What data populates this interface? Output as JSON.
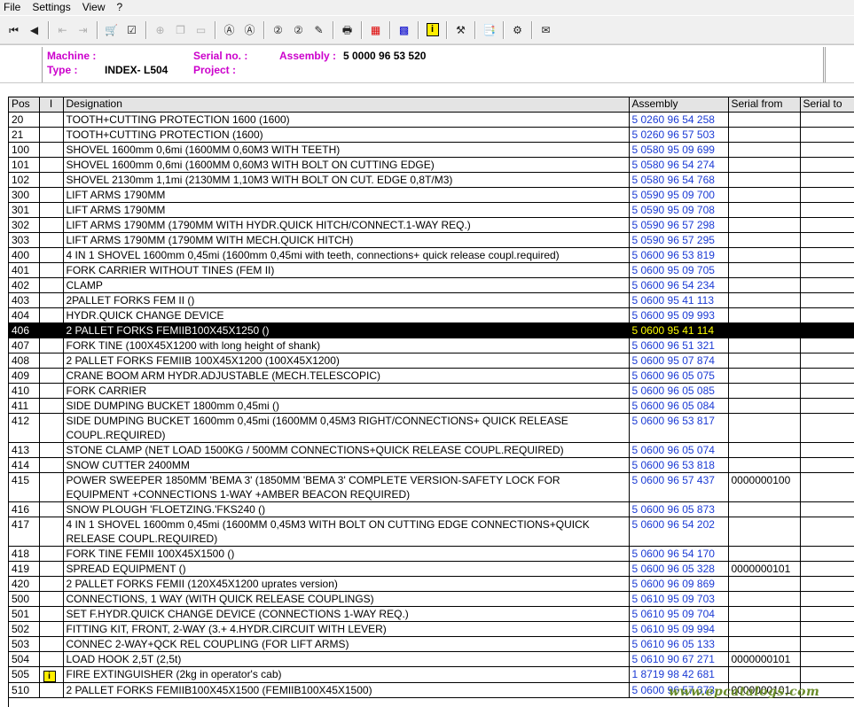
{
  "menu": [
    "File",
    "Settings",
    "View",
    "?"
  ],
  "toolbar": {
    "buttons": [
      {
        "name": "first-record-icon",
        "glyph": "⏮",
        "enabled": true
      },
      {
        "name": "prev-record-icon",
        "glyph": "◀",
        "enabled": true
      },
      {
        "name": "sep"
      },
      {
        "name": "back-doc-icon",
        "glyph": "⇤",
        "enabled": false
      },
      {
        "name": "forward-doc-icon",
        "glyph": "⇥",
        "enabled": false
      },
      {
        "name": "sep"
      },
      {
        "name": "basket-icon",
        "glyph": "🛒",
        "enabled": true
      },
      {
        "name": "edit-list-icon",
        "glyph": "☑",
        "enabled": true
      },
      {
        "name": "sep"
      },
      {
        "name": "zoom-in-icon",
        "glyph": "⊕",
        "enabled": false
      },
      {
        "name": "copy-icon",
        "glyph": "❐",
        "enabled": false
      },
      {
        "name": "page-icon",
        "glyph": "▭",
        "enabled": false
      },
      {
        "name": "sep"
      },
      {
        "name": "search-a-icon",
        "glyph": "Ⓐ",
        "enabled": true
      },
      {
        "name": "search-a-next-icon",
        "glyph": "Ⓐ",
        "enabled": true
      },
      {
        "name": "sep"
      },
      {
        "name": "search-2-icon",
        "glyph": "②",
        "enabled": true
      },
      {
        "name": "search-2-next-icon",
        "glyph": "②",
        "enabled": true
      },
      {
        "name": "note-icon",
        "glyph": "✎",
        "enabled": true
      },
      {
        "name": "sep"
      },
      {
        "name": "print-icon",
        "glyph": "🖶",
        "enabled": true
      },
      {
        "name": "sep"
      },
      {
        "name": "grid-red-icon",
        "glyph": "▦",
        "enabled": true,
        "color": "#dd0000"
      },
      {
        "name": "sep"
      },
      {
        "name": "grid-blue-icon",
        "glyph": "▩",
        "enabled": true,
        "color": "#0000cc"
      },
      {
        "name": "sep"
      },
      {
        "name": "info-icon",
        "glyph": "i",
        "enabled": true,
        "color": "#ffee00"
      },
      {
        "name": "sep"
      },
      {
        "name": "tools-icon",
        "glyph": "⚒",
        "enabled": true
      },
      {
        "name": "sep"
      },
      {
        "name": "catalog-icon",
        "glyph": "📑",
        "enabled": true
      },
      {
        "name": "sep"
      },
      {
        "name": "udds-icon",
        "glyph": "⚙",
        "enabled": true
      },
      {
        "name": "sep"
      },
      {
        "name": "mail-icon",
        "glyph": "✉",
        "enabled": true
      }
    ]
  },
  "header": {
    "machine_label": "Machine :",
    "machine_value": "",
    "type_label": "Type :",
    "type_value": "INDEX- L504",
    "serial_label": "Serial no. :",
    "serial_value": "",
    "project_label": "Project :",
    "project_value": "",
    "assembly_label": "Assembly :",
    "assembly_value": "5 0000 96 53 520"
  },
  "table": {
    "columns": [
      "Pos",
      "I",
      "Designation",
      "Assembly",
      "Serial from",
      "Serial to"
    ],
    "selected_pos": "406",
    "rows": [
      {
        "pos": "20",
        "i": "",
        "designation": "TOOTH+CUTTING PROTECTION 1600 (1600)",
        "assembly": "5 0260 96 54 258",
        "serial_from": "",
        "serial_to": ""
      },
      {
        "pos": "21",
        "i": "",
        "designation": "TOOTH+CUTTING PROTECTION (1600)",
        "assembly": "5 0260 96 57 503",
        "serial_from": "",
        "serial_to": ""
      },
      {
        "pos": "100",
        "i": "",
        "designation": "SHOVEL 1600mm 0,6mi (1600MM 0,60M3 WITH TEETH)",
        "assembly": "5 0580 95 09 699",
        "serial_from": "",
        "serial_to": ""
      },
      {
        "pos": "101",
        "i": "",
        "designation": "SHOVEL 1600mm 0,6mi (1600MM 0,60M3 WITH BOLT ON CUTTING EDGE)",
        "assembly": "5 0580 96 54 274",
        "serial_from": "",
        "serial_to": ""
      },
      {
        "pos": "102",
        "i": "",
        "designation": "SHOVEL 2130mm 1,1mi (2130MM 1,10M3 WITH BOLT ON CUT. EDGE 0,8T/M3)",
        "assembly": "5 0580 96 54 768",
        "serial_from": "",
        "serial_to": ""
      },
      {
        "pos": "300",
        "i": "",
        "designation": "LIFT ARMS 1790MM",
        "assembly": "5 0590 95 09 700",
        "serial_from": "",
        "serial_to": ""
      },
      {
        "pos": "301",
        "i": "",
        "designation": "LIFT ARMS 1790MM",
        "assembly": "5 0590 95 09 708",
        "serial_from": "",
        "serial_to": ""
      },
      {
        "pos": "302",
        "i": "",
        "designation": "LIFT ARMS 1790MM (1790MM WITH HYDR.QUICK HITCH/CONNECT.1-WAY REQ.)",
        "assembly": "5 0590 96 57 298",
        "serial_from": "",
        "serial_to": ""
      },
      {
        "pos": "303",
        "i": "",
        "designation": "LIFT ARMS 1790MM (1790MM WITH MECH.QUICK HITCH)",
        "assembly": "5 0590 96 57 295",
        "serial_from": "",
        "serial_to": ""
      },
      {
        "pos": "400",
        "i": "",
        "designation": "4 IN 1 SHOVEL 1600mm 0,45mi (1600mm 0,45mi with teeth, connections+ quick release coupl.required)",
        "assembly": "5 0600 96 53 819",
        "serial_from": "",
        "serial_to": ""
      },
      {
        "pos": "401",
        "i": "",
        "designation": "FORK CARRIER WITHOUT TINES (FEM II)",
        "assembly": "5 0600 95 09 705",
        "serial_from": "",
        "serial_to": ""
      },
      {
        "pos": "402",
        "i": "",
        "designation": "CLAMP",
        "assembly": "5 0600 96 54 234",
        "serial_from": "",
        "serial_to": ""
      },
      {
        "pos": "403",
        "i": "",
        "designation": "2PALLET FORKS FEM II ()",
        "assembly": "5 0600 95 41 113",
        "serial_from": "",
        "serial_to": ""
      },
      {
        "pos": "404",
        "i": "",
        "designation": "HYDR.QUICK CHANGE DEVICE",
        "assembly": "5 0600 95 09 993",
        "serial_from": "",
        "serial_to": ""
      },
      {
        "pos": "406",
        "i": "",
        "designation": "2 PALLET FORKS FEMIIB100X45X1250 ()",
        "assembly": "5 0600 95 41 114",
        "serial_from": "",
        "serial_to": ""
      },
      {
        "pos": "407",
        "i": "",
        "designation": "FORK TINE (100X45X1200 with long height of shank)",
        "assembly": "5 0600 96 51 321",
        "serial_from": "",
        "serial_to": ""
      },
      {
        "pos": "408",
        "i": "",
        "designation": "2 PALLET FORKS FEMIIB 100X45X1200 (100X45X1200)",
        "assembly": "5 0600 95 07 874",
        "serial_from": "",
        "serial_to": ""
      },
      {
        "pos": "409",
        "i": "",
        "designation": "CRANE BOOM ARM HYDR.ADJUSTABLE (MECH.TELESCOPIC)",
        "assembly": "5 0600 96 05 075",
        "serial_from": "",
        "serial_to": ""
      },
      {
        "pos": "410",
        "i": "",
        "designation": "FORK CARRIER",
        "assembly": "5 0600 96 05 085",
        "serial_from": "",
        "serial_to": ""
      },
      {
        "pos": "411",
        "i": "",
        "designation": "SIDE DUMPING BUCKET 1800mm 0,45mi ()",
        "assembly": "5 0600 96 05 084",
        "serial_from": "",
        "serial_to": ""
      },
      {
        "pos": "412",
        "i": "",
        "designation": "SIDE DUMPING BUCKET 1600mm 0,45mi (1600MM 0,45M3 RIGHT/CONNECTIONS+ QUICK RELEASE COUPL.REQUIRED)",
        "assembly": "5 0600 96 53 817",
        "serial_from": "",
        "serial_to": ""
      },
      {
        "pos": "413",
        "i": "",
        "designation": "STONE CLAMP (NET LOAD 1500KG / 500MM CONNECTIONS+QUICK RELEASE COUPL.REQUIRED)",
        "assembly": "5 0600 96 05 074",
        "serial_from": "",
        "serial_to": ""
      },
      {
        "pos": "414",
        "i": "",
        "designation": "SNOW CUTTER 2400MM",
        "assembly": "5 0600 96 53 818",
        "serial_from": "",
        "serial_to": ""
      },
      {
        "pos": "415",
        "i": "",
        "designation": "POWER SWEEPER 1850MM 'BEMA 3' (1850MM 'BEMA 3' COMPLETE VERSION-SAFETY LOCK FOR EQUIPMENT +CONNECTIONS 1-WAY +AMBER BEACON REQUIRED)",
        "assembly": "5 0600 96 57 437",
        "serial_from": "0000000100",
        "serial_to": ""
      },
      {
        "pos": "416",
        "i": "",
        "designation": "SNOW PLOUGH 'FLOETZING.'FKS240 ()",
        "assembly": "5 0600 96 05 873",
        "serial_from": "",
        "serial_to": ""
      },
      {
        "pos": "417",
        "i": "",
        "designation": "4 IN 1 SHOVEL 1600mm 0,45mi (1600MM 0,45M3 WITH BOLT ON CUTTING EDGE CONNECTIONS+QUICK RELEASE COUPL.REQUIRED)",
        "assembly": "5 0600 96 54 202",
        "serial_from": "",
        "serial_to": ""
      },
      {
        "pos": "418",
        "i": "",
        "designation": "FORK TINE FEMII 100X45X1500 ()",
        "assembly": "5 0600 96 54 170",
        "serial_from": "",
        "serial_to": ""
      },
      {
        "pos": "419",
        "i": "",
        "designation": "SPREAD EQUIPMENT ()",
        "assembly": "5 0600 96 05 328",
        "serial_from": "0000000101",
        "serial_to": ""
      },
      {
        "pos": "420",
        "i": "",
        "designation": "2 PALLET FORKS FEMII (120X45X1200 uprates version)",
        "assembly": "5 0600 96 09 869",
        "serial_from": "",
        "serial_to": ""
      },
      {
        "pos": "500",
        "i": "",
        "designation": "CONNECTIONS, 1 WAY (WITH QUICK RELEASE COUPLINGS)",
        "assembly": "5 0610 95 09 703",
        "serial_from": "",
        "serial_to": ""
      },
      {
        "pos": "501",
        "i": "",
        "designation": "SET F.HYDR.QUICK CHANGE DEVICE (CONNECTIONS 1-WAY REQ.)",
        "assembly": "5 0610 95 09 704",
        "serial_from": "",
        "serial_to": ""
      },
      {
        "pos": "502",
        "i": "",
        "designation": "FITTING KIT, FRONT, 2-WAY (3.+ 4.HYDR.CIRCUIT WITH LEVER)",
        "assembly": "5 0610 95 09 994",
        "serial_from": "",
        "serial_to": ""
      },
      {
        "pos": "503",
        "i": "",
        "designation": "CONNEC 2-WAY+QCK REL COUPLING (FOR LIFT ARMS)",
        "assembly": "5 0610 96 05 133",
        "serial_from": "",
        "serial_to": ""
      },
      {
        "pos": "504",
        "i": "",
        "designation": "LOAD HOOK 2,5T (2,5t)",
        "assembly": "5 0610 90 67 271",
        "serial_from": "0000000101",
        "serial_to": ""
      },
      {
        "pos": "505",
        "i": "i",
        "designation": "FIRE EXTINGUISHER (2kg in operator's cab)",
        "assembly": "1 8719 98 42 681",
        "serial_from": "",
        "serial_to": ""
      },
      {
        "pos": "510",
        "i": "",
        "designation": "2 PALLET FORKS FEMIIB100X45X1500 (FEMIIB100X45X1500)",
        "assembly": "5 0600 96 57 373",
        "serial_from": "0000000101",
        "serial_to": ""
      }
    ]
  },
  "watermark": "www.epcatalogs.com"
}
